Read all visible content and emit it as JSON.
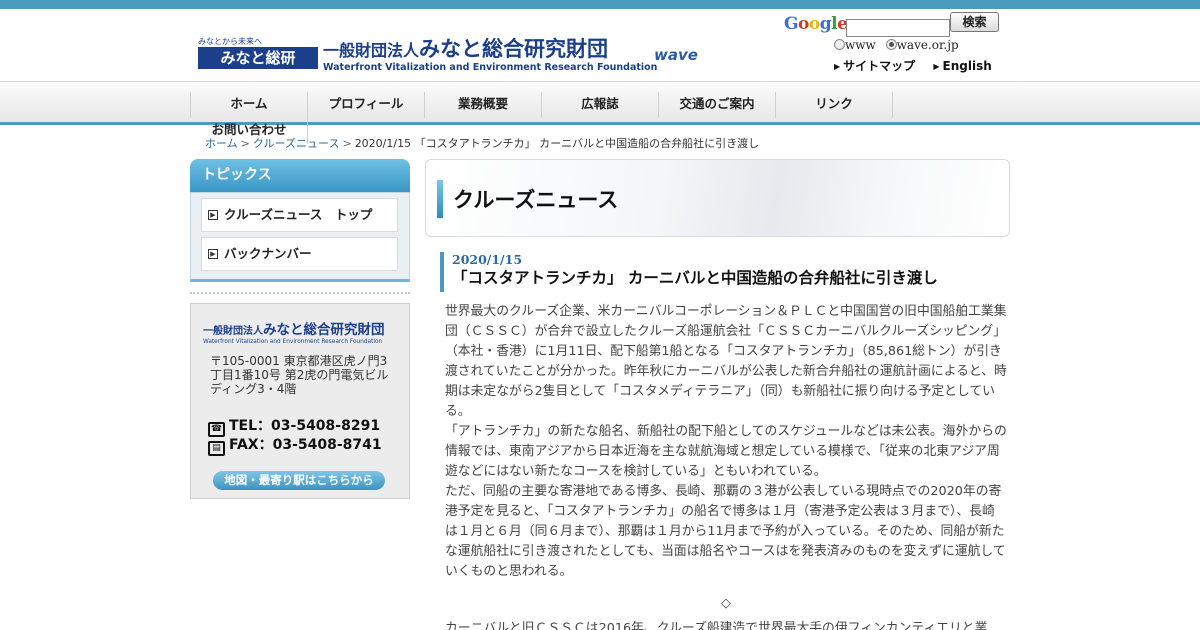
{
  "header": {
    "logo_small_tagline": "みなとから未来へ",
    "logo_small_text": "みなと総研",
    "logo_main_prefix": "一般財団法人",
    "logo_main_name": "みなと総合研究財団",
    "logo_main_en": "Waterfront Vitalization and Environment Research Foundation",
    "wave_mark": "wave"
  },
  "search": {
    "provider": "Google",
    "input_value": "",
    "button_label": "検索",
    "options": [
      "www",
      "wave.or.jp"
    ],
    "selected_option": "wave.or.jp"
  },
  "top_links": {
    "sitemap": "サイトマップ",
    "english": "English"
  },
  "nav": {
    "items": [
      "ホーム",
      "プロフィール",
      "業務概要",
      "広報誌",
      "交通のご案内",
      "リンク",
      "お問い合わせ"
    ]
  },
  "breadcrumb": {
    "home": "ホーム",
    "section": "クルーズニュース",
    "current": "2020/1/15 「コスタアトランチカ」 カーニバルと中国造船の合弁船社に引き渡し"
  },
  "sidebar": {
    "heading": "トピックス",
    "items": [
      "クルーズニュース　トップ",
      "バックナンバー"
    ],
    "info": {
      "org_prefix": "一般財団法人",
      "org_name": "みなと総合研究財団",
      "org_en": "Waterfront Vitalization and Environment Research Foundation",
      "address": "〒105-0001 東京都港区虎ノ門3丁目1番10号 第2虎の門電気ビルディング3・4階",
      "tel": "TEL：03-5408-8291",
      "fax": "FAX：03-5408-8741",
      "map_button": "地図・最寄り駅はこちらから"
    }
  },
  "main": {
    "section_title": "クルーズニュース",
    "article_date": "2020/1/15",
    "article_title": "「コスタアトランチカ」 カーニバルと中国造船の合弁船社に引き渡し",
    "paragraphs": [
      "世界最大のクルーズ企業、米カーニバルコーポレーション＆ＰＬＣと中国国営の旧中国船舶工業集団（ＣＳＳＣ）が合弁で設立したクルーズ船運航会社「ＣＳＳＣカーニバルクルーズシッピング」（本社・香港）に1月11日、配下船第1船となる「コスタアトランチカ」（85,861総トン）が引き渡されていたことが分かった。昨年秋にカーニバルが公表した新合弁船社の運航計画によると、時期は未定ながら2隻目として「コスタメディテラニア」（同）も新船社に振り向ける予定としている。",
      "「アトランチカ」の新たな船名、新船社の配下船としてのスケジュールなどは未公表。海外からの情報では、東南アジアから日本近海を主な就航海域と想定している模様で、「従来の北東アジア周遊などにはない新たなコースを検討している」ともいわれている。",
      "ただ、同船の主要な寄港地である博多、長崎、那覇の３港が公表している現時点での2020年の寄港予定を見ると、「コスタアトランチカ」の船名で博多は１月（寄港予定公表は３月まで）、長崎は１月と６月（同６月まで）、那覇は１月から11月まで予約が入っている。そのため、同船が新たな運航船社に引き渡されたとしても、当面は船名やコースはを発表済みのものを変えずに運航していくものと思われる。"
    ],
    "divider": "◇",
    "cut_paragraph": "カーニバルと旧ＣＳＳＣは2016年、クルーズ船建造で世界最大手の伊フィンカンティエリと業"
  },
  "colors": {
    "accent": "#4a9bbf",
    "brand": "#1c3f8c",
    "link": "#2a6aa0"
  }
}
